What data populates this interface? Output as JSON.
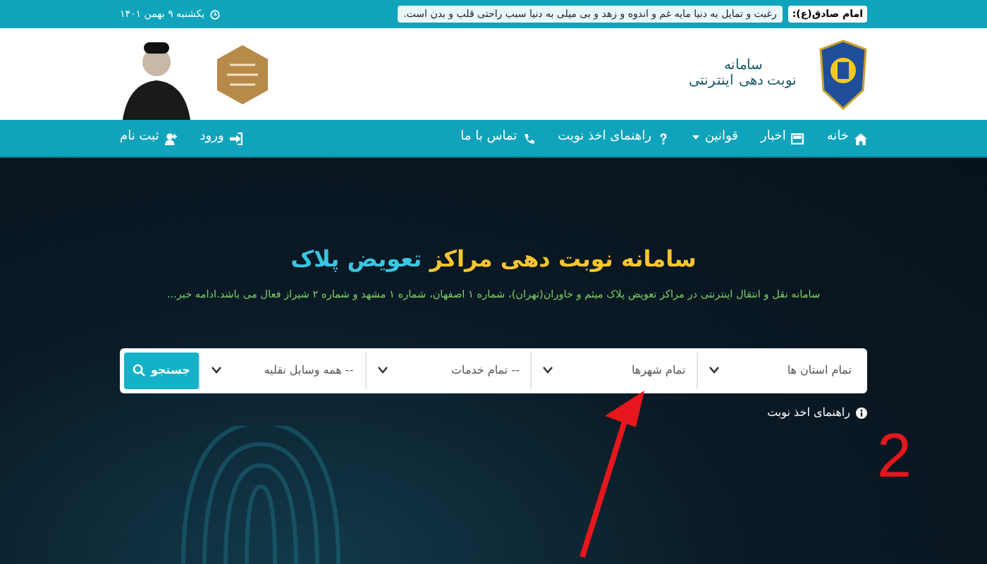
{
  "top_bar": {
    "quote_label": "امام صادق(ع):",
    "quote": "رغبت و تمایل به دنیا مایه غم و اندوه و زهد و بی میلی به دنیا سبب راحتی قلب و بدن است.",
    "date": "یکشنبه ۹ بهمن ۱۴۰۱"
  },
  "header": {
    "logo_line_1": "سامانه",
    "logo_line_2": "نوبت دهی اینترنتی"
  },
  "nav": {
    "items": [
      {
        "label": "خانه",
        "dropdown": false
      },
      {
        "label": "اخبار",
        "dropdown": false
      },
      {
        "label": "قوانین",
        "dropdown": true
      },
      {
        "label": "راهنمای اخذ نوبت",
        "dropdown": false
      },
      {
        "label": "تماس با ما",
        "dropdown": false
      }
    ],
    "account": [
      {
        "label": "ورود"
      },
      {
        "label": "ثبت نام"
      }
    ]
  },
  "hero": {
    "title_main": "سامانه نوبت دهی مراکز",
    "title_highlight": "تعویض پلاک",
    "description": "سامانه نقل و انتقال اینترنتی در مراکز تعویض پلاک میثم و خاوران(تهران)، شماره ۱ اصفهان، شماره ۱ مشهد و شماره ۲ شیراز فعال می باشد.ادامه خبر..."
  },
  "search": {
    "selects": [
      "تمام استان ها",
      "تمام شهرها",
      "-- تمام خدمات",
      "-- همه وسایل نقلیه"
    ],
    "button": "جستجو",
    "guide_link": "راهنمای اخذ نوبت"
  },
  "annotation": {
    "label": "2"
  }
}
